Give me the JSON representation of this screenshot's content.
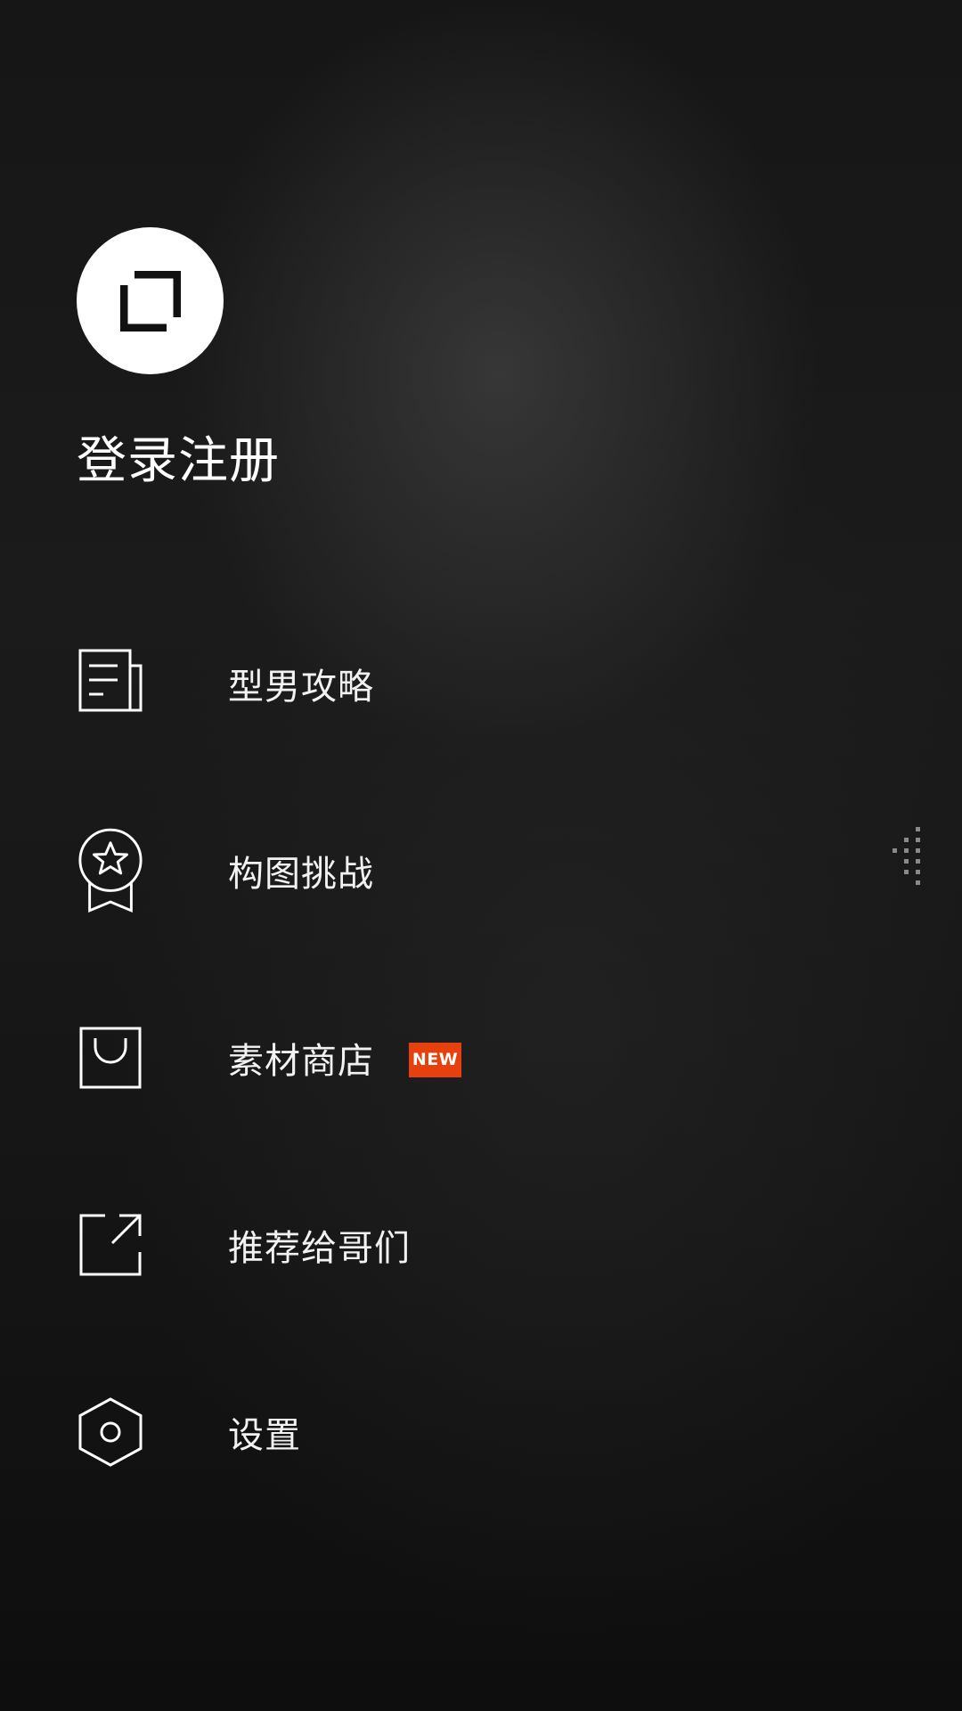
{
  "profile": {
    "login_label": "登录注册",
    "avatar_icon": "app-logo-icon"
  },
  "menu": {
    "items": [
      {
        "label": "型男攻略",
        "icon": "article-icon"
      },
      {
        "label": "构图挑战",
        "icon": "award-badge-icon"
      },
      {
        "label": "素材商店",
        "icon": "shopping-bag-icon",
        "badge": "NEW"
      },
      {
        "label": "推荐给哥们",
        "icon": "share-icon"
      },
      {
        "label": "设置",
        "icon": "settings-hexagon-icon"
      }
    ]
  },
  "colors": {
    "background": "#111111",
    "text": "#ffffff",
    "badge": "#e8400c"
  }
}
